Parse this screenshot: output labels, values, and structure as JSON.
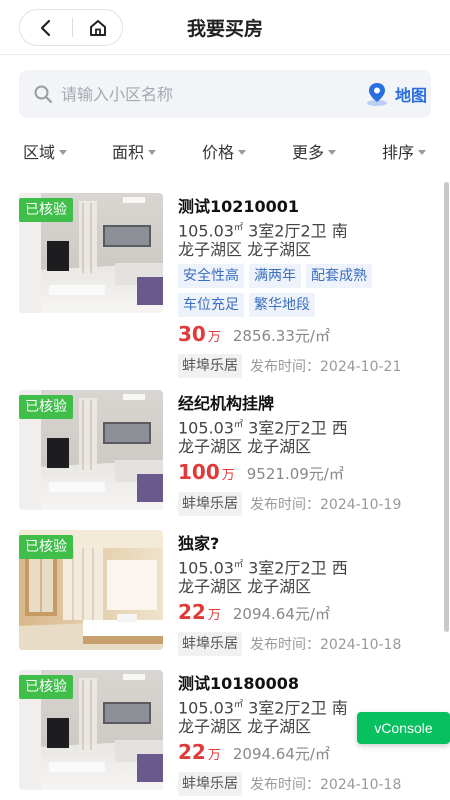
{
  "header": {
    "title": "我要买房",
    "back_icon": "chevron-left-icon",
    "home_icon": "home-icon"
  },
  "search": {
    "placeholder": "请输入小区名称",
    "value": "",
    "map_label": "地图"
  },
  "filters": [
    {
      "label": "区域"
    },
    {
      "label": "面积"
    },
    {
      "label": "价格"
    },
    {
      "label": "更多"
    },
    {
      "label": "排序"
    }
  ],
  "listings": [
    {
      "badge": "已核验",
      "title": "测试10210001",
      "area": "105.03",
      "area_unit": "㎡",
      "layout": "3室2厅2卫",
      "orientation": "南",
      "district": "龙子湖区",
      "community": "龙子湖区",
      "tags": [
        "安全性高",
        "满两年",
        "配套成熟",
        "车位充足",
        "繁华地段"
      ],
      "price": "30",
      "price_unit": "万",
      "unit_price": "2856.33元/㎡",
      "agency": "蚌埠乐居",
      "publish_label": "发布时间：",
      "publish_date": "2024-10-21"
    },
    {
      "badge": "已核验",
      "title": "经纪机构挂牌",
      "area": "105.03",
      "area_unit": "㎡",
      "layout": "3室2厅2卫",
      "orientation": "西",
      "district": "龙子湖区",
      "community": "龙子湖区",
      "tags": [],
      "price": "100",
      "price_unit": "万",
      "unit_price": "9521.09元/㎡",
      "agency": "蚌埠乐居",
      "publish_label": "发布时间：",
      "publish_date": "2024-10-19"
    },
    {
      "badge": "已核验",
      "title": "独家?",
      "area": "105.03",
      "area_unit": "㎡",
      "layout": "3室2厅2卫",
      "orientation": "西",
      "district": "龙子湖区",
      "community": "龙子湖区",
      "tags": [],
      "price": "22",
      "price_unit": "万",
      "unit_price": "2094.64元/㎡",
      "agency": "蚌埠乐居",
      "publish_label": "发布时间：",
      "publish_date": "2024-10-18"
    },
    {
      "badge": "已核验",
      "title": "测试10180008",
      "area": "105.03",
      "area_unit": "㎡",
      "layout": "3室2厅2卫",
      "orientation": "南",
      "district": "龙子湖区",
      "community": "龙子湖区",
      "tags": [],
      "price": "22",
      "price_unit": "万",
      "unit_price": "2094.64元/㎡",
      "agency": "蚌埠乐居",
      "publish_label": "发布时间：",
      "publish_date": "2024-10-18"
    }
  ],
  "vconsole": {
    "label": "vConsole"
  },
  "colors": {
    "accent_blue": "#2a6fe0",
    "price_red": "#e03a3a",
    "badge_green": "#3fbf4a",
    "vconsole_green": "#07c160"
  }
}
